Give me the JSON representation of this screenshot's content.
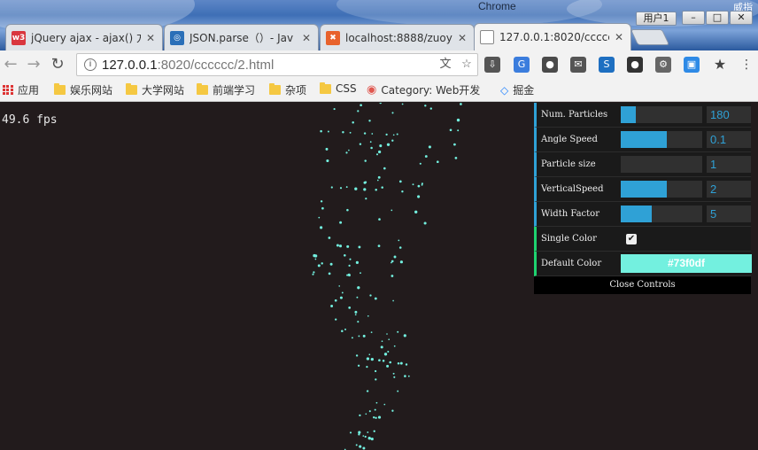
{
  "window": {
    "title": "Chrome",
    "user_label": "用户1",
    "corner_text": "威指"
  },
  "tabs": [
    {
      "label": "jQuery ajax - ajax() 方",
      "favicon": "w3",
      "favicon_color": "#d9363e",
      "active": false
    },
    {
      "label": "JSON.parse（）- Jav",
      "favicon": "json-icon",
      "favicon_color": "#2a6fb8",
      "active": false
    },
    {
      "label": "localhost:8888/zuoy",
      "favicon": "xampp-icon",
      "favicon_color": "#e8622c",
      "active": false
    },
    {
      "label": "127.0.0.1:8020/ccccc",
      "favicon": "page-icon",
      "favicon_color": "#888888",
      "active": true
    }
  ],
  "toolbar": {
    "url_host": "127.0.0.1",
    "url_rest": ":8020/cccccc/2.html"
  },
  "bookmarks": [
    {
      "label": "应用",
      "icon": "apps-icon"
    },
    {
      "label": "娱乐网站",
      "icon": "folder-icon"
    },
    {
      "label": "大学网站",
      "icon": "folder-icon"
    },
    {
      "label": "前端学习",
      "icon": "folder-icon"
    },
    {
      "label": "杂项",
      "icon": "folder-icon"
    },
    {
      "label": "CSS",
      "icon": "folder-icon"
    },
    {
      "label": "Category: Web开发",
      "icon": "location-pin-icon"
    },
    {
      "label": "掘金",
      "icon": "juejin-icon"
    }
  ],
  "page": {
    "fps_text": "49.6 fps",
    "particle_color": "#73f0df",
    "background_color": "#221b1c"
  },
  "controls": {
    "num_particles": {
      "label": "Num. Particles",
      "value": "180",
      "fill_fraction": 0.18
    },
    "angle_speed": {
      "label": "Angle Speed",
      "value": "0.1",
      "fill_fraction": 0.56
    },
    "particle_size": {
      "label": "Particle size",
      "value": "1",
      "fill_fraction": 0.0
    },
    "vertical_speed": {
      "label": "VerticalSpeed",
      "value": "2",
      "fill_fraction": 0.56
    },
    "width_factor": {
      "label": "Width Factor",
      "value": "5",
      "fill_fraction": 0.38
    },
    "single_color": {
      "label": "Single Color",
      "checked": true
    },
    "default_color": {
      "label": "Default Color",
      "value": "#73f0df"
    },
    "close_label": "Close Controls"
  }
}
